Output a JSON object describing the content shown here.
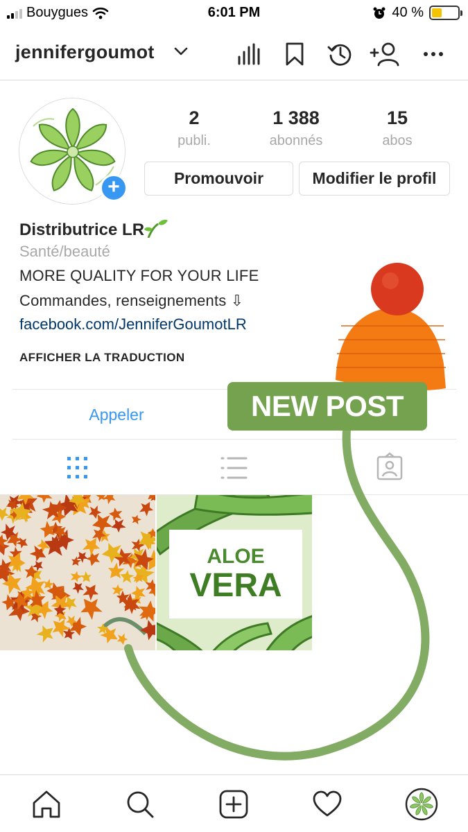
{
  "status_bar": {
    "carrier": "Bouygues",
    "time": "6:01 PM",
    "battery_percent": "40 %",
    "battery_level": 0.4,
    "icons": [
      "signal-icon",
      "wifi-icon",
      "alarm-icon",
      "battery-icon"
    ]
  },
  "header": {
    "username": "jennifergoumot",
    "icons": [
      "chevron-down-icon",
      "insights-icon",
      "bookmark-icon",
      "history-icon",
      "add-person-icon",
      "more-icon"
    ]
  },
  "profile": {
    "stats": [
      {
        "value": "2",
        "label": "publi."
      },
      {
        "value": "1 388",
        "label": "abonnés"
      },
      {
        "value": "15",
        "label": "abos"
      }
    ],
    "promote_label": "Promouvoir",
    "edit_label": "Modifier le profil",
    "name": "Distributrice LR",
    "category": "Santé/beauté",
    "bio_line1": "MORE QUALITY FOR YOUR LIFE",
    "bio_line2": "Commandes, renseignements ⇩",
    "link": "facebook.com/JenniferGoumotLR",
    "translate": "AFFICHER LA TRADUCTION",
    "call_label": "Appeler"
  },
  "tabs": [
    "grid-icon",
    "list-icon",
    "tagged-icon"
  ],
  "posts": [
    {
      "kind": "autumn-leaves"
    },
    {
      "kind": "aloe-vera",
      "line1": "ALOE",
      "line2": "VERA"
    }
  ],
  "sticker": {
    "label": "NEW POST",
    "colors": {
      "banner": "#74a24f",
      "hat": "#f47a14",
      "pompom": "#d9391f"
    }
  },
  "bottom_nav": [
    "home-icon",
    "search-icon",
    "create-icon",
    "heart-icon",
    "profile-avatar"
  ],
  "colors": {
    "accent": "#3897f0",
    "link": "#00376b",
    "muted": "#a8a8a8"
  }
}
